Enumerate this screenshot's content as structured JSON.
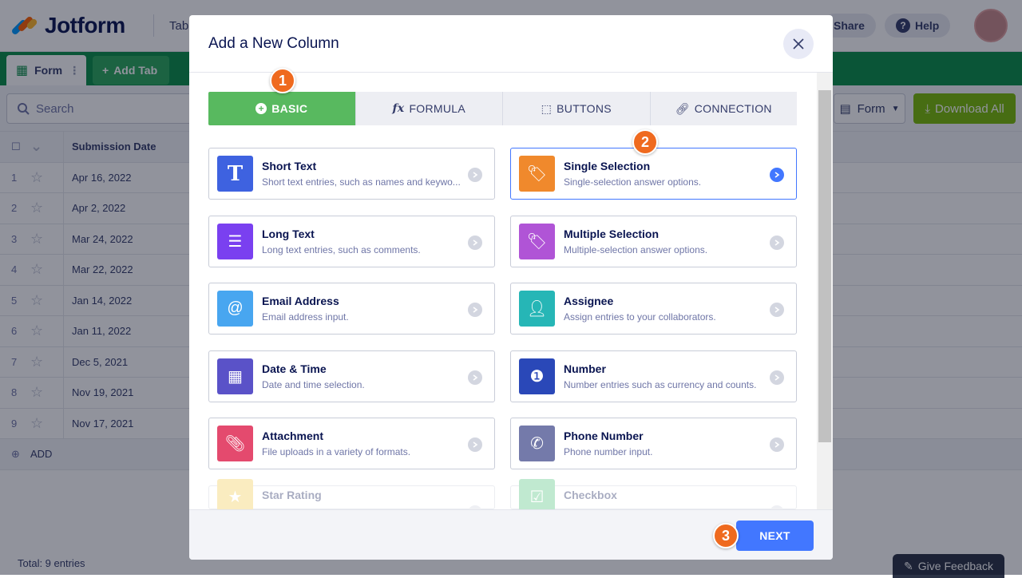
{
  "app": {
    "logo_text": "Jotform",
    "tab_title": "Tab",
    "share": "Share",
    "help": "Help"
  },
  "tabs": {
    "form": "Form",
    "add_tab": "Add Tab"
  },
  "toolbar": {
    "search_placeholder": "Search",
    "form_select": "Form",
    "download_all": "Download All"
  },
  "grid": {
    "header": "Submission Date",
    "rows": [
      {
        "num": "1",
        "date": "Apr 16, 2022"
      },
      {
        "num": "2",
        "date": "Apr 2, 2022"
      },
      {
        "num": "3",
        "date": "Mar 24, 2022"
      },
      {
        "num": "4",
        "date": "Mar 22, 2022"
      },
      {
        "num": "5",
        "date": "Jan 14, 2022"
      },
      {
        "num": "6",
        "date": "Jan 11, 2022"
      },
      {
        "num": "7",
        "date": "Dec 5, 2021"
      },
      {
        "num": "8",
        "date": "Nov 19, 2021"
      },
      {
        "num": "9",
        "date": "Nov 17, 2021"
      }
    ],
    "add": "ADD",
    "total": "Total: 9 entries"
  },
  "feedback": "Give Feedback",
  "modal": {
    "title": "Add a New Column",
    "type_tabs": [
      "BASIC",
      "FORMULA",
      "BUTTONS",
      "CONNECTION"
    ],
    "cards": [
      {
        "title": "Short Text",
        "desc": "Short text entries, such as names and keywo...",
        "color": "#3e62e0",
        "icon": "text-icon"
      },
      {
        "title": "Single Selection",
        "desc": "Single-selection answer options.",
        "color": "#f0892c",
        "icon": "tag-icon"
      },
      {
        "title": "Long Text",
        "desc": "Long text entries, such as comments.",
        "color": "#7a40f0",
        "icon": "paragraph-icon"
      },
      {
        "title": "Multiple Selection",
        "desc": "Multiple-selection answer options.",
        "color": "#b054d6",
        "icon": "tags-icon"
      },
      {
        "title": "Email Address",
        "desc": "Email address input.",
        "color": "#48a6f0",
        "icon": "at-icon"
      },
      {
        "title": "Assignee",
        "desc": "Assign entries to your collaborators.",
        "color": "#26b6b6",
        "icon": "user-icon"
      },
      {
        "title": "Date & Time",
        "desc": "Date and time selection.",
        "color": "#5a52c8",
        "icon": "calendar-icon"
      },
      {
        "title": "Number",
        "desc": "Number entries such as currency and counts.",
        "color": "#2a48b8",
        "icon": "number-icon"
      },
      {
        "title": "Attachment",
        "desc": "File uploads in a variety of formats.",
        "color": "#e44a6e",
        "icon": "paperclip-icon"
      },
      {
        "title": "Phone Number",
        "desc": "Phone number input.",
        "color": "#747aaa",
        "icon": "phone-icon"
      },
      {
        "title": "Star Rating",
        "desc": "",
        "color": "#f2c94c",
        "icon": "star-icon"
      },
      {
        "title": "Checkbox",
        "desc": "",
        "color": "#4cc37a",
        "icon": "checkbox-icon"
      }
    ],
    "next": "NEXT"
  },
  "badges": [
    "1",
    "2",
    "3"
  ]
}
